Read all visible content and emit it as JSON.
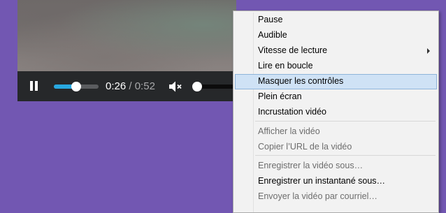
{
  "player": {
    "time_current": "0:26",
    "time_separator": " / ",
    "time_duration": "0:52",
    "progress_fraction": 0.5,
    "volume_fraction": 0.0,
    "muted": true
  },
  "menu": {
    "items": [
      {
        "label": "Pause",
        "disabled": false
      },
      {
        "label": "Audible",
        "disabled": false
      },
      {
        "label": "Vitesse de lecture",
        "disabled": false,
        "submenu": true
      },
      {
        "label": "Lire en boucle",
        "disabled": false
      },
      {
        "label": "Masquer les contrôles",
        "disabled": false,
        "highlighted": true
      },
      {
        "label": "Plein écran",
        "disabled": false
      },
      {
        "label": "Incrustation vidéo",
        "disabled": false
      },
      {
        "label": "Afficher la vidéo",
        "disabled": true
      },
      {
        "label": "Copier l’URL de la vidéo",
        "disabled": true
      },
      {
        "label": "Enregistrer la vidéo sous…",
        "disabled": true
      },
      {
        "label": "Enregistrer un instantané sous…",
        "disabled": false
      },
      {
        "label": "Envoyer la vidéo par courriel…",
        "disabled": true
      }
    ]
  },
  "colors": {
    "desktop_background": "#7257b2",
    "control_bar": "#26282a",
    "progress_fill": "#28a8e0",
    "menu_background": "#f2f2f2",
    "menu_highlight": "#cfe2f5"
  }
}
